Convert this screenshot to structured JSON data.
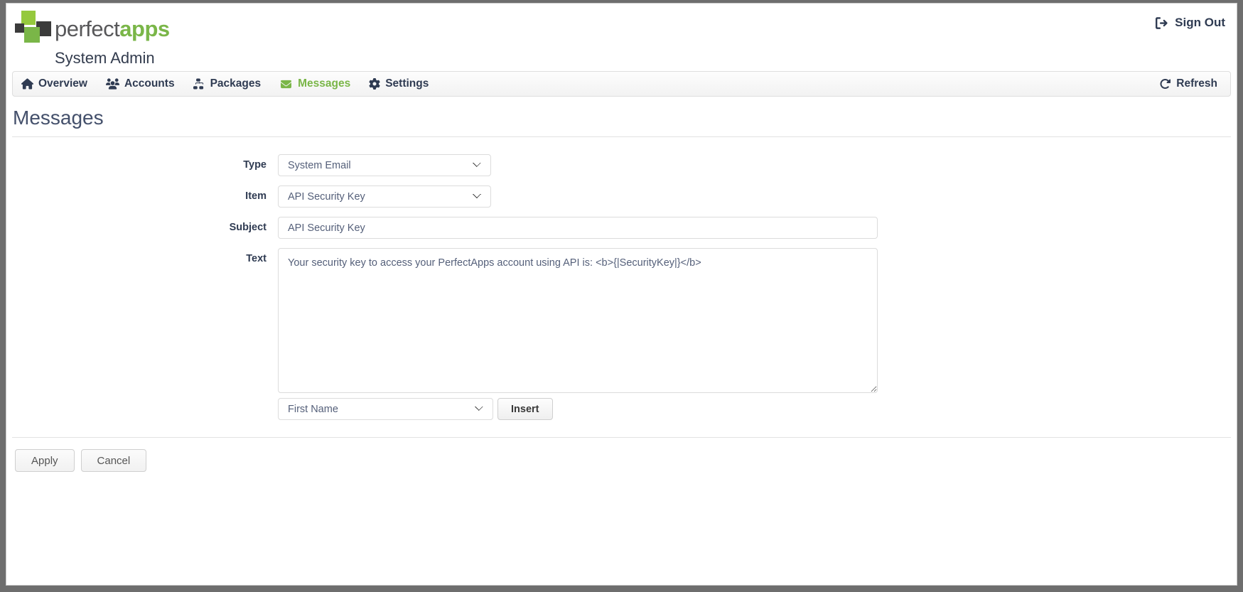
{
  "header": {
    "logo_text_primary": "perfect",
    "logo_text_accent": "apps",
    "subtitle": "System Admin",
    "signout_label": "Sign Out",
    "signout_icon": "sign-out-icon",
    "logo_colors": {
      "green_light": "#95c93d",
      "green": "#7ab648",
      "dark": "#3b3b3b"
    }
  },
  "nav": {
    "items": [
      {
        "label": "Overview",
        "icon": "home-icon",
        "active": false
      },
      {
        "label": "Accounts",
        "icon": "users-icon",
        "active": false
      },
      {
        "label": "Packages",
        "icon": "boxes-icon",
        "active": false
      },
      {
        "label": "Messages",
        "icon": "envelope-icon",
        "active": true
      },
      {
        "label": "Settings",
        "icon": "gear-icon",
        "active": false
      }
    ],
    "refresh_label": "Refresh",
    "refresh_icon": "refresh-icon",
    "active_color": "#7ab648"
  },
  "page": {
    "title": "Messages"
  },
  "form": {
    "type": {
      "label": "Type",
      "value": "System Email",
      "options": [
        "System Email"
      ]
    },
    "item": {
      "label": "Item",
      "value": "API Security Key",
      "options": [
        "API Security Key"
      ]
    },
    "subject": {
      "label": "Subject",
      "value": "API Security Key",
      "placeholder": ""
    },
    "text": {
      "label": "Text",
      "value": "Your security key to access your PerfectApps account using API is: <b>{|SecurityKey|}</b>",
      "placeholder": ""
    },
    "variable": {
      "value": "First Name",
      "options": [
        "First Name"
      ]
    },
    "insert_label": "Insert"
  },
  "footer": {
    "apply_label": "Apply",
    "cancel_label": "Cancel"
  }
}
